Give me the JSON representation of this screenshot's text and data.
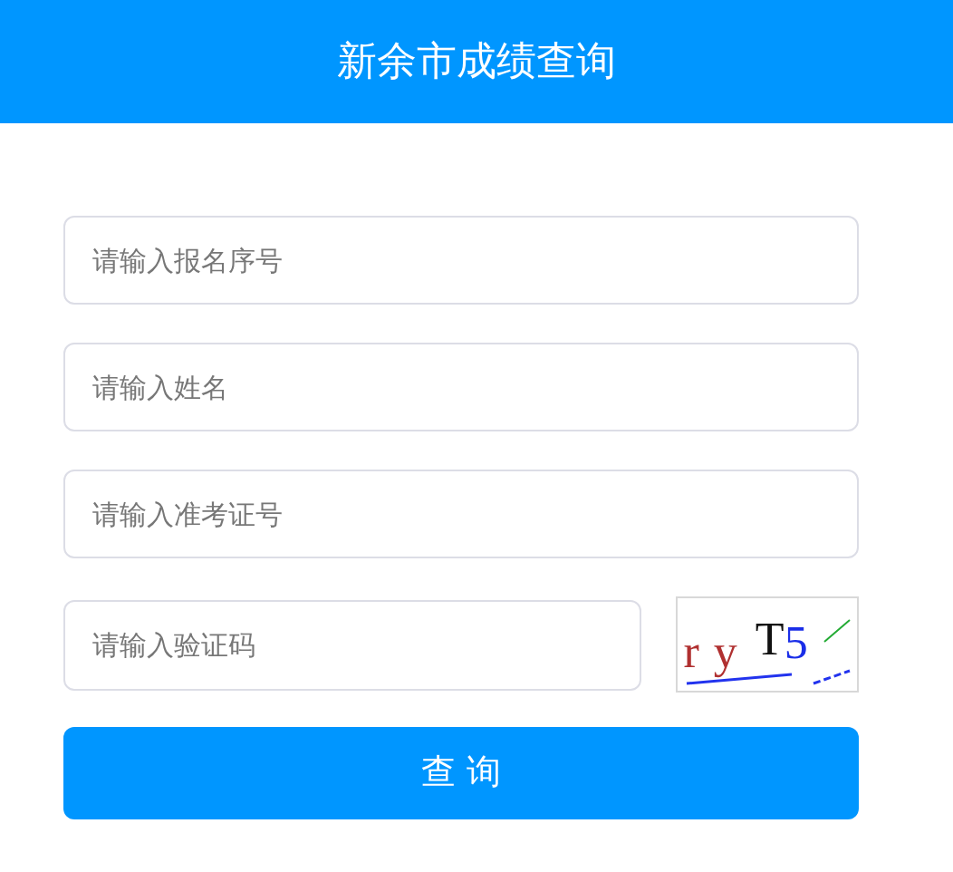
{
  "header": {
    "title": "新余市成绩查询"
  },
  "fields": [
    {
      "placeholder": "请输入报名序号"
    },
    {
      "placeholder": "请输入姓名"
    },
    {
      "placeholder": "请输入准考证号"
    }
  ],
  "captcha_field": {
    "placeholder": "请输入验证码"
  },
  "captcha": {
    "chars": [
      {
        "text": "r",
        "color": "#b03030"
      },
      {
        "text": "y",
        "color": "#b03030"
      },
      {
        "text": "T",
        "color": "#111111"
      },
      {
        "text": "5",
        "color": "#1a2ee8"
      }
    ]
  },
  "submit": {
    "label": "查 询"
  }
}
